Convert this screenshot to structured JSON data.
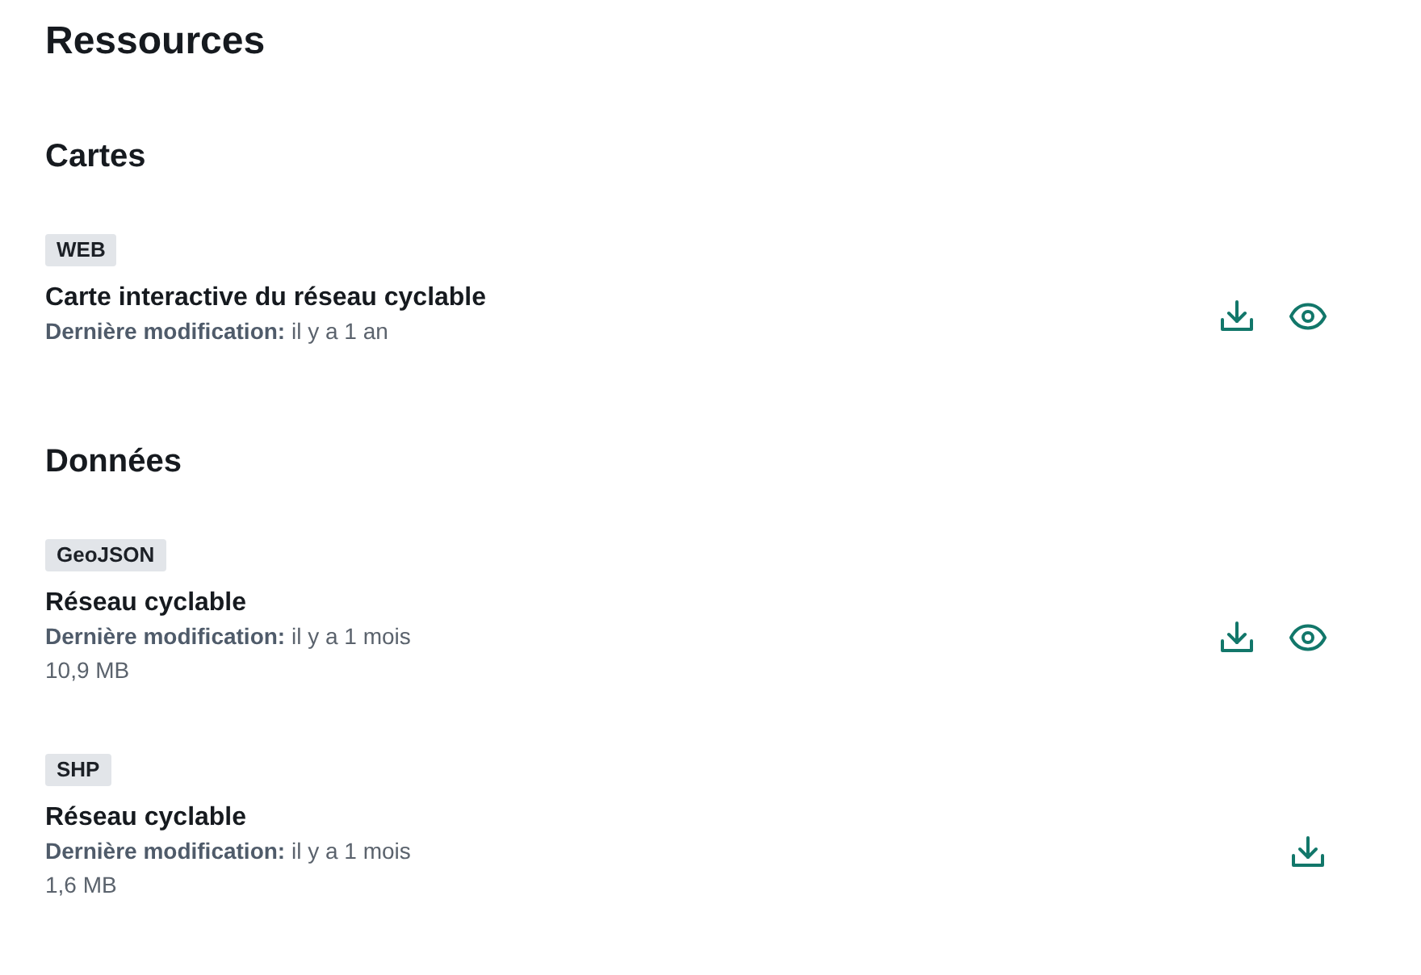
{
  "page_title": "Ressources",
  "sections": [
    {
      "heading": "Cartes",
      "resources": [
        {
          "format": "WEB",
          "title": "Carte interactive du réseau cyclable",
          "modified": "**Dernière modification:** il y a 1 an",
          "actions": [
            {
              "kind": "download"
            },
            {
              "kind": "view"
            }
          ]
        }
      ]
    },
    {
      "heading": "Données",
      "resources": [
        {
          "format": "GeoJSON",
          "title": "Réseau cyclable",
          "modified": "**Dernière modification:** il y a 1 mois",
          "size": "10,9 MB",
          "actions": [
            {
              "kind": "download"
            },
            {
              "kind": "view"
            }
          ]
        },
        {
          "format": "SHP",
          "title": "Réseau cyclable",
          "modified": "**Dernière modification:** il y a 1 mois",
          "size": "1,6 MB",
          "actions": [
            {
              "kind": "download"
            }
          ]
        }
      ]
    }
  ]
}
